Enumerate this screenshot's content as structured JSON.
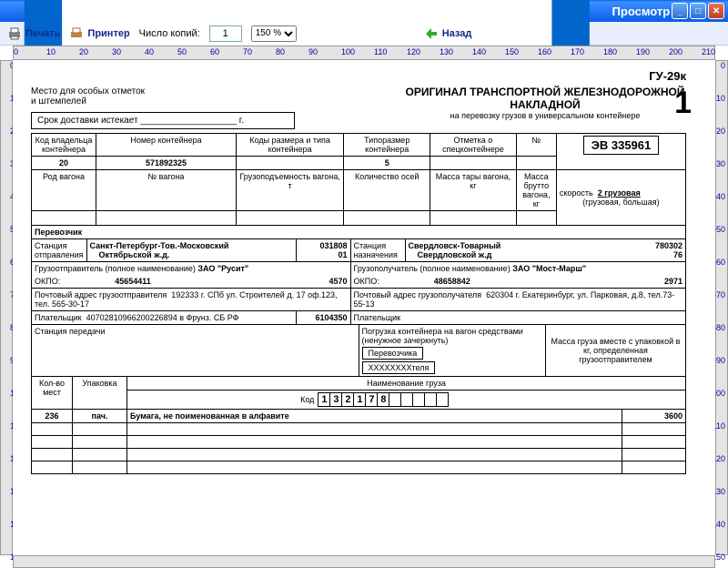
{
  "window": {
    "title": "Просмотр"
  },
  "toolbar": {
    "print": "Печать",
    "printer": "Принтер",
    "copies_label": "Число копий:",
    "copies": "1",
    "zoom": "150 %",
    "back": "Назад"
  },
  "ruler_h": [
    "0",
    "10",
    "20",
    "30",
    "40",
    "50",
    "60",
    "70",
    "80",
    "90",
    "100",
    "110",
    "120",
    "130",
    "140",
    "150",
    "160",
    "170",
    "180",
    "190",
    "200",
    "210"
  ],
  "ruler_v": [
    "0",
    "-10",
    "-20",
    "-30",
    "-40",
    "-50",
    "-60",
    "-70",
    "-80",
    "-90",
    "-100",
    "-110",
    "-120",
    "-130",
    "-140",
    "-150"
  ],
  "form": {
    "code": "ГУ-29к",
    "stamp_note": "Место для особых отметок\nи штемпелей",
    "head_t1": "ОРИГИНАЛ ТРАНСПОРТНОЙ ЖЕЛЕЗНОДОРОЖНОЙ НАКЛАДНОЙ",
    "head_t2": "на перевозку грузов в универсальном контейнере",
    "delivery": "Срок доставки истекает ___________________ г.",
    "labels": {
      "owner": "Код владельца контейнера",
      "cont_num": "Номер контейнера",
      "size_codes": "Коды размера и типа контейнера",
      "typesize": "Типоразмер контейнера",
      "spec_mark": "Отметка о спецконтейнере",
      "num": "№",
      "wagon_type": "Род вагона",
      "wagon_num": "№ вагона",
      "capacity": "Грузоподъемность вагона, т",
      "axes": "Количество осей",
      "tare": "Масса тары вагона, кг",
      "gross": "Масса брутто вагона, кг",
      "speed": "скорость",
      "speed_note": "(грузовая, большая)",
      "carrier": "Перевозчик",
      "st_from": "Станция отправления",
      "st_to": "Станция назначения",
      "sender": "Грузоотправитель (полное наименование)",
      "receiver": "Грузополучатель (полное наименование)",
      "okpo": "ОКПО:",
      "post_from": "Почтовый адрес грузоотправителя",
      "post_to": "Почтовый адрес грузополучателя",
      "payer": "Плательщик",
      "transfer": "Станция передачи",
      "loading": "Погрузка контейнера на вагон средствами (ненужное зачеркнуть)",
      "load_carrier": "Перевозчика",
      "load_sender": "ХХХХХХХХтеля",
      "mass_note": "Масса груза вместе с упаковкой в кг, определенная грузоотправителем",
      "qty": "Кол-во мест",
      "pack": "Упаковка",
      "cargo": "Наименование груза",
      "code": "Код"
    },
    "v": {
      "owner": "20",
      "cont_num": "571892325",
      "typesize": "5",
      "number": "ЭВ 335961",
      "speed": "2 грузовая",
      "st_from_name": "Санкт-Петербург-Тов.-Московский",
      "st_from_code": "031808",
      "st_from_rail": "Октябрьской ж.д.",
      "st_from_rail_code": "01",
      "st_to_name": "Свердловск-Товарный",
      "st_to_code": "780302",
      "st_to_rail": "Свердловской ж.д",
      "st_to_rail_code": "76",
      "sender_name": "ЗАО \"Русит\"",
      "sender_okpo": "45654411",
      "sender_okpo2": "4570",
      "receiver_name": "ЗАО \"Мост-Марш\"",
      "receiver_okpo": "48658842",
      "receiver_okpo2": "2971",
      "post_from": "192333 г. СПб ул. Строителей д. 17 оф.123, тел. 565-30-17",
      "post_to": "620304 г. Екатеринбург, ул. Парковая, д.8, тел.73-55-13",
      "payer": "40702810966200226894 в Фрунз. СБ РФ",
      "payer_code": "6104350",
      "qty": "236",
      "pack": "пач.",
      "cargo_name": "Бумага, не поименованная в алфавите",
      "mass": "3600",
      "code_digits": [
        "1",
        "3",
        "2",
        "1",
        "7",
        "8",
        "",
        "",
        "",
        "",
        ""
      ]
    }
  }
}
